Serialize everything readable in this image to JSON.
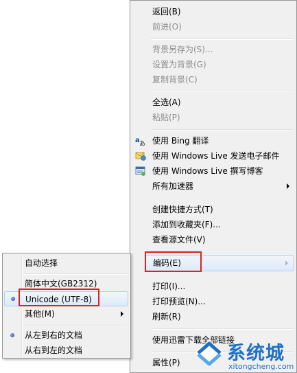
{
  "main_menu": {
    "items": [
      {
        "label": "返回(B)",
        "disabled": false
      },
      {
        "label": "前进(O)",
        "disabled": true
      },
      {
        "label": "背景另存为(S)...",
        "disabled": true
      },
      {
        "label": "设置为背景(G)",
        "disabled": true
      },
      {
        "label": "复制背景(C)",
        "disabled": true
      },
      {
        "label": "全选(A)",
        "disabled": false
      },
      {
        "label": "粘贴(P)",
        "disabled": true
      },
      {
        "label": "使用 Bing 翻译",
        "disabled": false,
        "icon": "bing-translate-icon"
      },
      {
        "label": "使用 Windows Live 发送电子邮件",
        "disabled": false,
        "icon": "email-icon"
      },
      {
        "label": "使用 Windows Live 撰写博客",
        "disabled": false,
        "icon": "blog-icon"
      },
      {
        "label": "所有加速器",
        "disabled": false,
        "submenu": true
      },
      {
        "label": "创建快捷方式(T)",
        "disabled": false
      },
      {
        "label": "添加到收藏夹(F)...",
        "disabled": false
      },
      {
        "label": "查看源文件(V)",
        "disabled": false
      },
      {
        "label": "编码(E)",
        "disabled": false,
        "submenu": true,
        "highlighted": true
      },
      {
        "label": "打印(I)...",
        "disabled": false
      },
      {
        "label": "打印预览(N)...",
        "disabled": false
      },
      {
        "label": "刷新(R)",
        "disabled": false
      },
      {
        "label": "使用迅雷下载全部链接",
        "disabled": false
      },
      {
        "label": "属性(P)",
        "disabled": false
      }
    ]
  },
  "encoding_submenu": {
    "items": [
      {
        "label": "自动选择"
      },
      {
        "label": "简体中文(GB2312)"
      },
      {
        "label": "Unicode (UTF-8)",
        "selected": true,
        "highlighted": true
      },
      {
        "label": "其他(M)",
        "submenu": true
      },
      {
        "label": "从左到右的文档",
        "selected": true
      },
      {
        "label": "从右到左的文档"
      }
    ]
  },
  "watermark": {
    "brand": "系统城",
    "url": "xitongcheng.com"
  },
  "colors": {
    "highlight_border": "#aecff7",
    "annotation_red": "#e02020",
    "watermark_blue": "#1f6fc6"
  }
}
